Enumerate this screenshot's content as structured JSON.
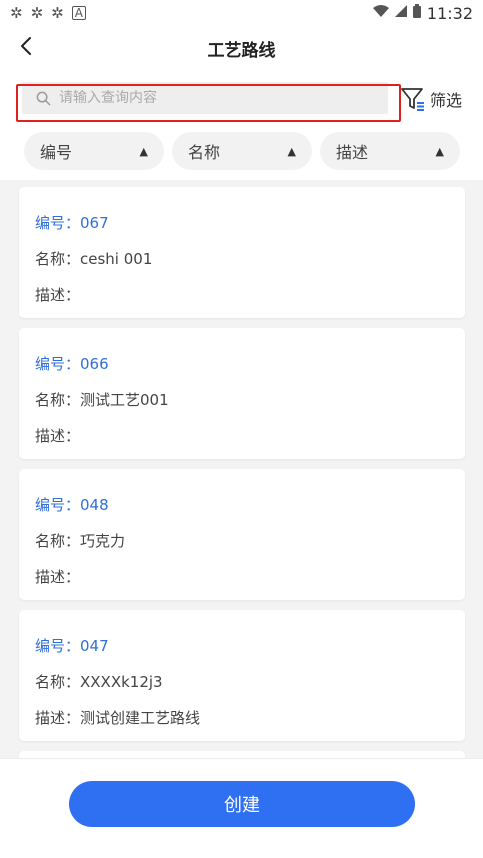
{
  "status_bar": {
    "time": "11:32",
    "left_icons": [
      "sync-icon",
      "sync-icon",
      "sync-icon",
      "app-icon"
    ],
    "right_icons": [
      "wifi-icon",
      "signal-icon",
      "battery-icon"
    ]
  },
  "header": {
    "title": "工艺路线",
    "back_icon": "chevron-left-icon"
  },
  "search": {
    "placeholder": "请输入查询内容",
    "value": "",
    "icon": "search-icon"
  },
  "filter": {
    "label": "筛选",
    "icon": "filter-icon"
  },
  "sort_options": [
    {
      "label": "编号",
      "icon": "triangle-up-icon"
    },
    {
      "label": "名称",
      "icon": "triangle-up-icon"
    },
    {
      "label": "描述",
      "icon": "triangle-up-icon"
    }
  ],
  "items": [
    {
      "code": "编号：067",
      "name": "名称：ceshi 001",
      "desc": "描述："
    },
    {
      "code": "编号：066",
      "name": "名称：测试工艺001",
      "desc": "描述："
    },
    {
      "code": "编号：048",
      "name": "名称：巧克力",
      "desc": "描述："
    },
    {
      "code": "编号：047",
      "name": "名称：XXXXk12j3",
      "desc": "描述：测试创建工艺路线"
    }
  ],
  "actions": {
    "create_label": "创建"
  },
  "colors": {
    "accent": "#2f6ff2",
    "code_text": "#2f6fdc",
    "highlight_border": "#e02020",
    "list_background": "#f3f3f3"
  }
}
